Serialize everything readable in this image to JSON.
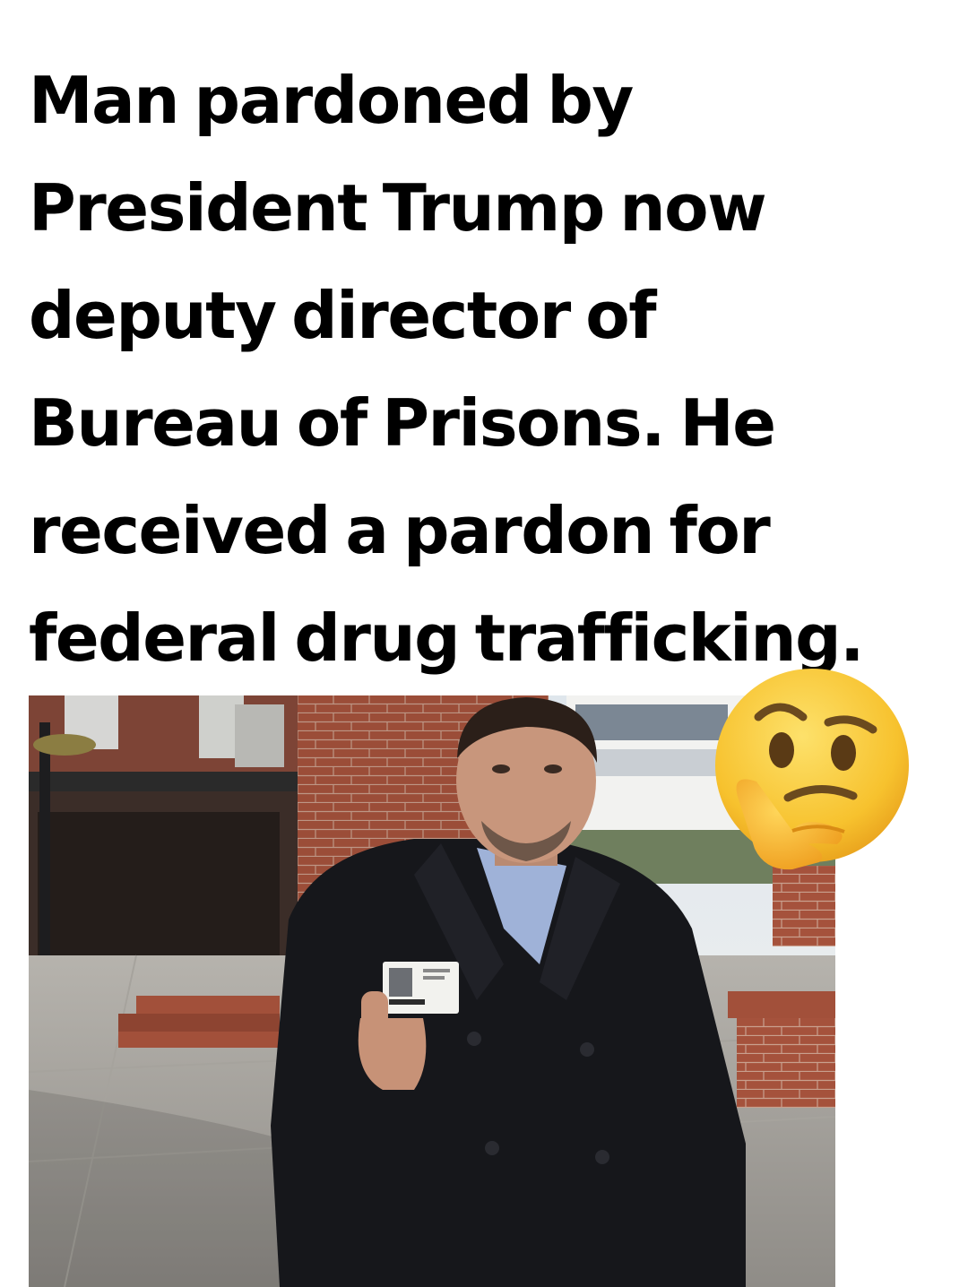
{
  "headline": {
    "lines": [
      "Man pardoned by",
      "President Trump now",
      "deputy director of",
      "Bureau of Prisons. He",
      "received a pardon for",
      "federal drug trafficking."
    ]
  },
  "photo": {
    "description_icon": "man-holding-id-card-photo"
  },
  "emoji": {
    "icon": "thinking-face-icon"
  },
  "colors": {
    "text": "#000000",
    "background": "#ffffff",
    "emoji_yellow": "#f7c22e",
    "coat": "#16171b",
    "brick": "#a5523c"
  }
}
